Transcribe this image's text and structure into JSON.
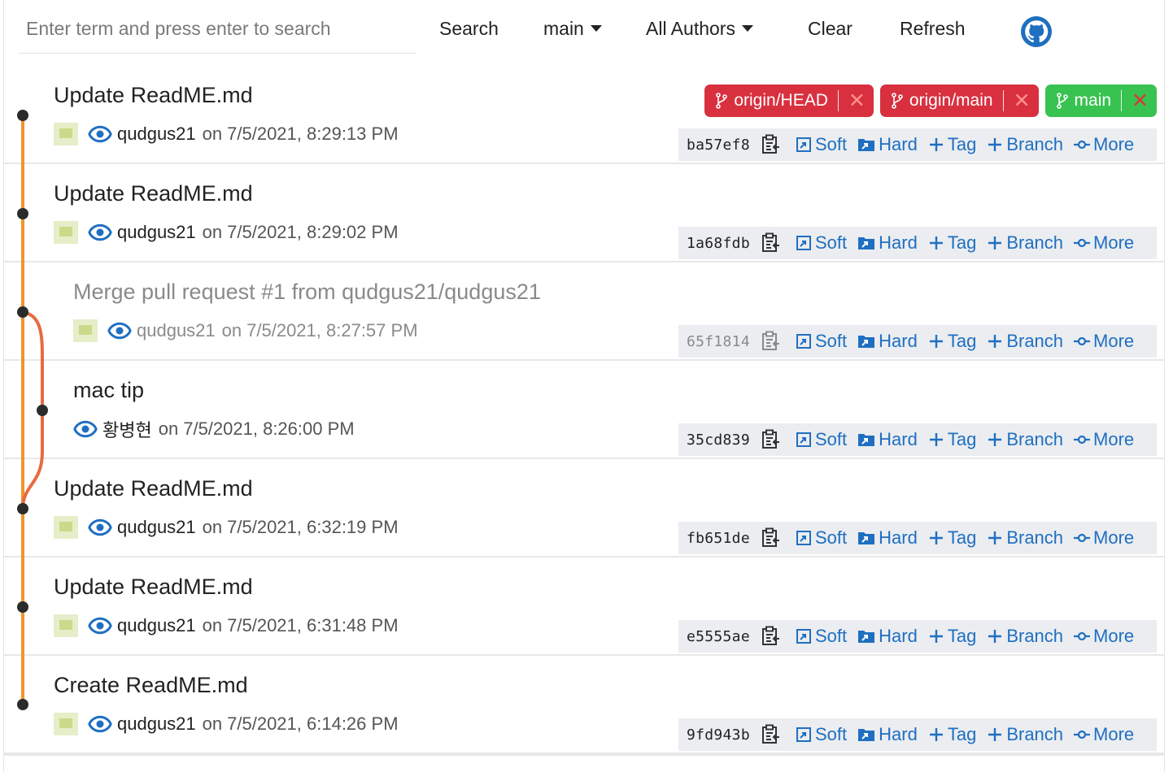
{
  "toolbar": {
    "search_placeholder": "Enter term and press enter to search",
    "search_value": "",
    "search_label": "Search",
    "branch_select": "main",
    "authors_select": "All Authors",
    "clear_label": "Clear",
    "refresh_label": "Refresh",
    "github_icon": "github-icon"
  },
  "colors": {
    "graph_main": "#f0932b",
    "graph_branch": "#e86a40",
    "link_blue": "#1f6fc1",
    "badge_red": "#d9303f",
    "badge_green": "#38c250"
  },
  "commits": [
    {
      "message": "Update ReadME.md",
      "author": "qudgus21",
      "on": "on",
      "date": "7/5/2021, 8:29:13 PM",
      "sha": "ba57ef8",
      "has_avatar": true,
      "faded": false,
      "branches": [
        {
          "name": "origin/HEAD",
          "color": "red",
          "remove": "✕"
        },
        {
          "name": "origin/main",
          "color": "red",
          "remove": "✕"
        },
        {
          "name": "main",
          "color": "green",
          "remove": "✕"
        }
      ]
    },
    {
      "message": "Update ReadME.md",
      "author": "qudgus21",
      "on": "on",
      "date": "7/5/2021, 8:29:02 PM",
      "sha": "1a68fdb",
      "has_avatar": true,
      "faded": false,
      "branches": []
    },
    {
      "message": "Merge pull request #1 from qudgus21/qudgus21",
      "author": "qudgus21",
      "on": "on",
      "date": "7/5/2021, 8:27:57 PM",
      "sha": "65f1814",
      "has_avatar": true,
      "faded": true,
      "branches": []
    },
    {
      "message": "mac tip",
      "author": "황병현",
      "on": "on",
      "date": "7/5/2021, 8:26:00 PM",
      "sha": "35cd839",
      "has_avatar": false,
      "faded": false,
      "branches": []
    },
    {
      "message": "Update ReadME.md",
      "author": "qudgus21",
      "on": "on",
      "date": "7/5/2021, 6:32:19 PM",
      "sha": "fb651de",
      "has_avatar": true,
      "faded": false,
      "branches": []
    },
    {
      "message": "Update ReadME.md",
      "author": "qudgus21",
      "on": "on",
      "date": "7/5/2021, 6:31:48 PM",
      "sha": "e5555ae",
      "has_avatar": true,
      "faded": false,
      "branches": []
    },
    {
      "message": "Create ReadME.md",
      "author": "qudgus21",
      "on": "on",
      "date": "7/5/2021, 6:14:26 PM",
      "sha": "9fd943b",
      "has_avatar": true,
      "faded": false,
      "branches": []
    }
  ],
  "actions": {
    "soft": "Soft",
    "hard": "Hard",
    "tag": "Tag",
    "branch": "Branch",
    "more": "More"
  },
  "icons": {
    "copy": "copy-icon",
    "soft": "soft-reset-icon",
    "hard": "hard-reset-icon",
    "tag": "plus-icon",
    "branch": "plus-icon",
    "more": "commit-icon",
    "view": "eye-icon",
    "avatar": "avatar-image",
    "branch_badge": "git-branch-icon",
    "remove_badge": "close-icon"
  }
}
